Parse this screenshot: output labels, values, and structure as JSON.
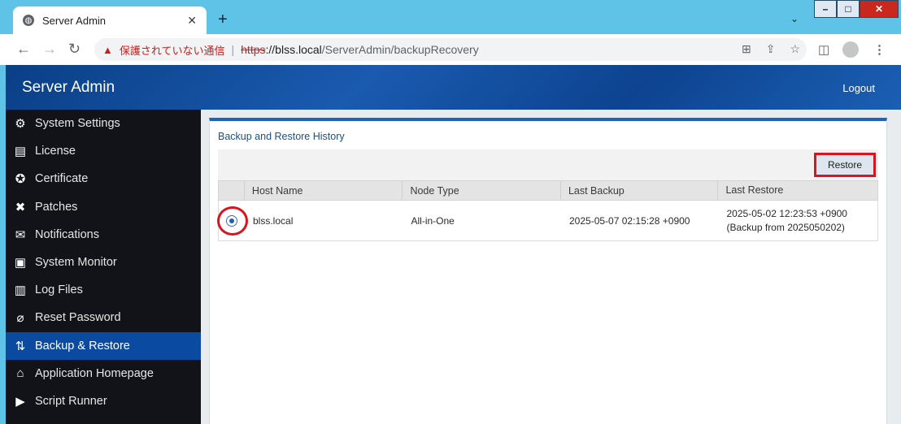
{
  "browser": {
    "tab_title": "Server Admin",
    "tab_close": "✕",
    "new_tab": "+",
    "security_warning": "保護されていない通信",
    "url_scheme": "https",
    "url_host": "://blss.local",
    "url_path": "/ServerAdmin/backupRecovery"
  },
  "app": {
    "title": "Server Admin",
    "logout_label": "Logout"
  },
  "sidebar": {
    "items": [
      {
        "label": "System Settings",
        "icon": "system-settings-icon",
        "glyph": "⚙"
      },
      {
        "label": "License",
        "icon": "license-icon",
        "glyph": "▤"
      },
      {
        "label": "Certificate",
        "icon": "certificate-icon",
        "glyph": "✪"
      },
      {
        "label": "Patches",
        "icon": "patches-icon",
        "glyph": "✖"
      },
      {
        "label": "Notifications",
        "icon": "notifications-icon",
        "glyph": "✉"
      },
      {
        "label": "System Monitor",
        "icon": "system-monitor-icon",
        "glyph": "▣"
      },
      {
        "label": "Log Files",
        "icon": "log-files-icon",
        "glyph": "▥"
      },
      {
        "label": "Reset Password",
        "icon": "reset-password-icon",
        "glyph": "⌀"
      },
      {
        "label": "Backup & Restore",
        "icon": "backup-restore-icon",
        "glyph": "⇅"
      },
      {
        "label": "Application Homepage",
        "icon": "home-icon",
        "glyph": "⌂"
      },
      {
        "label": "Script Runner",
        "icon": "script-runner-icon",
        "glyph": "▶"
      }
    ],
    "active_index": 8
  },
  "panel": {
    "title": "Backup and Restore History",
    "restore_label": "Restore",
    "columns": [
      "Host Name",
      "Node Type",
      "Last Backup",
      "Last Restore"
    ],
    "rows": [
      {
        "selected": true,
        "host_name": "blss.local",
        "node_type": "All-in-One",
        "last_backup": "2025-05-07 02:15:28 +0900",
        "last_restore": "2025-05-02 12:23:53 +0900 (Backup from 2025050202)"
      }
    ]
  },
  "colors": {
    "header_blue": "#0a3f86",
    "sidebar_bg": "#111319",
    "active_item": "#0b4aa1",
    "highlight_red": "#d8141f"
  }
}
